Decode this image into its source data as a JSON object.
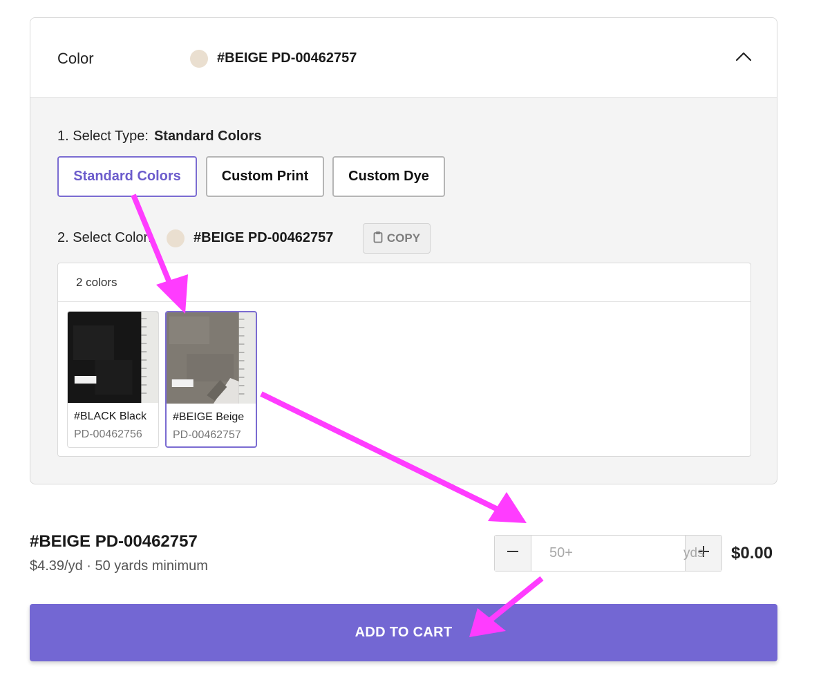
{
  "colors": {
    "accent": "#7367d3",
    "selected_border": "#7a6bd1",
    "beige_swatch": "#eadfd0",
    "annotation_arrow": "#ff3cff"
  },
  "header": {
    "label": "Color",
    "selected_value": "#BEIGE PD-00462757",
    "toggle_icon": "chevron-up-icon"
  },
  "type_select": {
    "label": "1. Select Type:",
    "current": "Standard Colors",
    "options": [
      "Standard Colors",
      "Custom Print",
      "Custom Dye"
    ],
    "active_index": 0
  },
  "color_select": {
    "label": "2. Select Color:",
    "value": "#BEIGE PD-00462757",
    "copy_label": "COPY",
    "copy_icon": "clipboard-icon",
    "count_label": "2 colors",
    "items": [
      {
        "name": "#BLACK Black",
        "code": "PD-00462756",
        "tag": "BLACK",
        "selected": false
      },
      {
        "name": "#BEIGE Beige",
        "code": "PD-00462757",
        "tag": "BEIGE",
        "selected": true
      }
    ]
  },
  "summary": {
    "name": "#BEIGE PD-00462757",
    "price_line": "$4.39/yd · 50 yards minimum",
    "qty_placeholder": "50+",
    "unit": "yds",
    "minus_icon": "minus-icon",
    "plus_icon": "plus-icon",
    "total": "$0.00"
  },
  "cart": {
    "label": "ADD TO CART"
  }
}
